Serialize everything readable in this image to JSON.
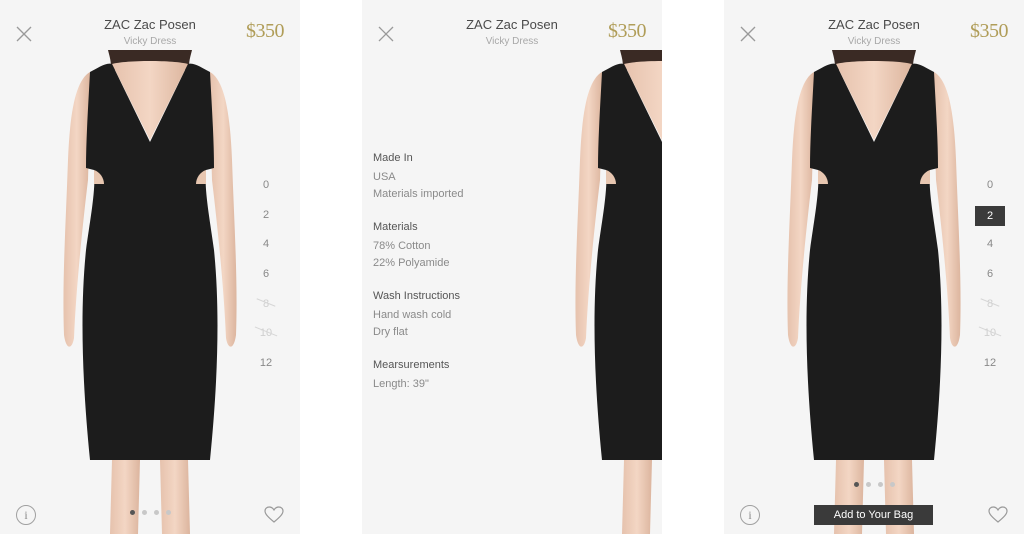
{
  "product": {
    "brand": "ZAC Zac Posen",
    "model": "Vicky Dress",
    "price": "$350"
  },
  "sizes": [
    "0",
    "2",
    "4",
    "6",
    "8",
    "10",
    "12"
  ],
  "out_of_stock_sizes": [
    "8",
    "10"
  ],
  "selected_size": "2",
  "details": {
    "made_in": {
      "title": "Made In",
      "lines": [
        "USA",
        "Materials imported"
      ]
    },
    "materials": {
      "title": "Materials",
      "lines": [
        "78% Cotton",
        "22% Polyamide"
      ]
    },
    "wash": {
      "title": "Wash Instructions",
      "lines": [
        "Hand wash cold",
        "Dry flat"
      ]
    },
    "measurements": {
      "title": "Mearsurements",
      "lines": [
        "Length: 39\""
      ]
    }
  },
  "actions": {
    "add_to_bag": "Add to Your Bag",
    "info_glyph": "i"
  },
  "carousel": {
    "count": 4,
    "active_index": 0
  },
  "icons": [
    "close-icon",
    "info-icon",
    "heart-icon"
  ],
  "colors": {
    "price": "#b09d58",
    "selected_size_bg": "#3a3a3a",
    "add_button_bg": "#3a3a3a"
  }
}
